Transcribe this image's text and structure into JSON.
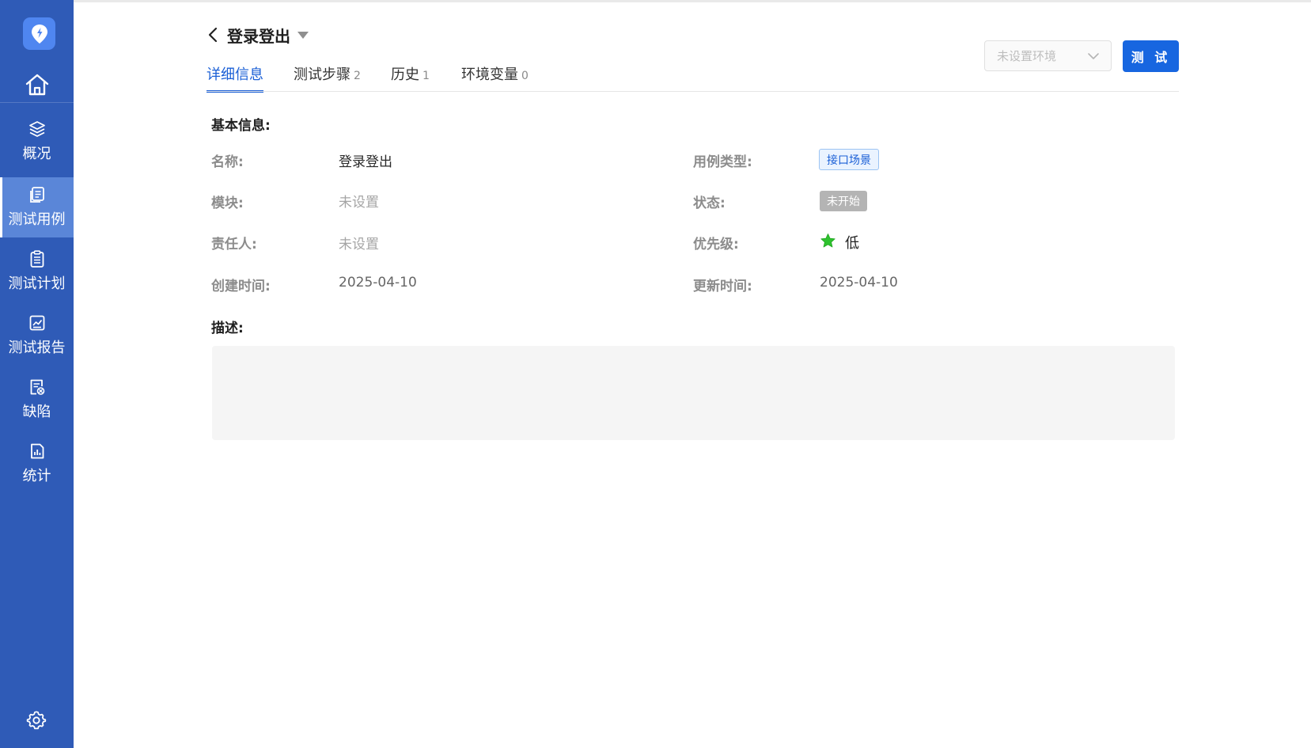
{
  "sidebar": {
    "items": [
      {
        "label": "概况",
        "icon": "layers-icon"
      },
      {
        "label": "测试用例",
        "icon": "document-icon"
      },
      {
        "label": "测试计划",
        "icon": "clipboard-icon"
      },
      {
        "label": "测试报告",
        "icon": "chart-report-icon"
      },
      {
        "label": "缺陷",
        "icon": "bug-list-icon"
      },
      {
        "label": "统计",
        "icon": "bar-chart-icon"
      }
    ],
    "active_item": "测试用例",
    "colors": {
      "background": "#2f5bb7",
      "active": "#5a86d8",
      "logo": "#4f86f0"
    }
  },
  "header": {
    "title": "登录登出",
    "tabs": [
      {
        "label": "详细信息",
        "count": ""
      },
      {
        "label": "测试步骤",
        "count": "2"
      },
      {
        "label": "历史",
        "count": "1"
      },
      {
        "label": "环境变量",
        "count": "0"
      }
    ],
    "active_tab": "详细信息",
    "env_select": {
      "placeholder": "未设置环境"
    },
    "test_button": "测 试",
    "accent": "#1766e0"
  },
  "basic_info": {
    "section_title": "基本信息:",
    "name": {
      "label": "名称:",
      "value": "登录登出"
    },
    "module": {
      "label": "模块:",
      "value": "未设置"
    },
    "owner": {
      "label": "责任人:",
      "value": "未设置"
    },
    "created": {
      "label": "创建时间:",
      "value": "2025-04-10"
    },
    "case_type": {
      "label": "用例类型:",
      "value": "接口场景"
    },
    "status": {
      "label": "状态:",
      "value": "未开始"
    },
    "priority": {
      "label": "优先级:",
      "value": "低",
      "icon": "star-icon",
      "color": "#2ec22e"
    },
    "updated": {
      "label": "更新时间:",
      "value": "2025-04-10"
    }
  },
  "description": {
    "section_title": "描述:",
    "value": ""
  }
}
